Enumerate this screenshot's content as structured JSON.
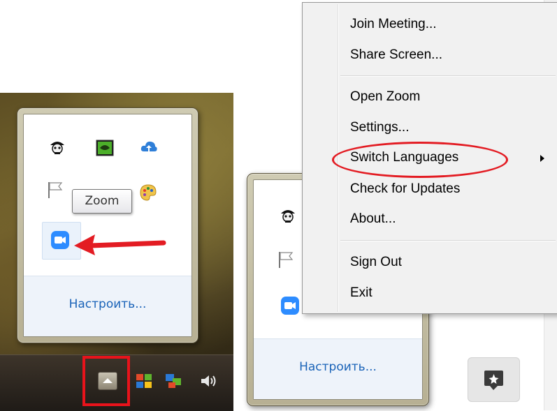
{
  "tooltip": {
    "text": "Zoom"
  },
  "flyout": {
    "customize_label": "Настроить..."
  },
  "context_menu": {
    "groups": [
      {
        "items": [
          "Join Meeting...",
          "Share Screen..."
        ]
      },
      {
        "items": [
          "Open Zoom",
          "Settings...",
          "Switch Languages",
          "Check for Updates",
          "About..."
        ]
      },
      {
        "items": [
          "Sign Out",
          "Exit"
        ]
      }
    ]
  },
  "annotation_colors": {
    "red": "#e31c23",
    "link_blue": "#1a63b8",
    "zoom_blue": "#2d8cff"
  },
  "icons": [
    "pirate-skull-icon",
    "nvidia-icon",
    "cloud-upload-icon",
    "flag-icon",
    "palette-icon",
    "zoom-app-icon",
    "tray-expand-icon",
    "windows-flag-icon",
    "speaker-icon",
    "context-help-icon"
  ]
}
